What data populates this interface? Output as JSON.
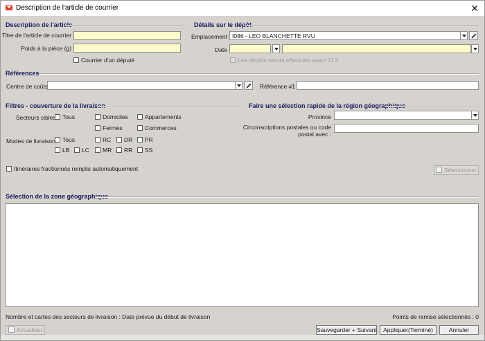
{
  "window": {
    "title": "Description de l'article de courrier",
    "close_glyph": "✕"
  },
  "article": {
    "section": "Description de l'article",
    "title_label": "Titre de l'article de courrier",
    "title_value": "",
    "weight_label": "Poids à la pièce (g)",
    "weight_value": "",
    "mp_label": "Courrier d'un député"
  },
  "deposit": {
    "section": "Détails sur le dépôt",
    "location_label": "Emplacement",
    "location_value": "I086 - LEO BLANCHETTE RVU",
    "date_label": "Date",
    "date_value": "",
    "time_value": "",
    "note": "Les dépôts seront effectués avant 11 h"
  },
  "references": {
    "section": "Références",
    "cost_center_label": "Centre de coûts",
    "cost_center_value": "",
    "ref1_label": "Référence #1",
    "ref1_value": ""
  },
  "filters": {
    "section": "Filtres - couverture de la livraison",
    "target_label": "Secteurs cibles",
    "target": [
      "Tous",
      "Domiciles",
      "Appartements",
      "Fermes",
      "Commerces"
    ],
    "modes_label": "Modes de livraison",
    "modes": [
      "Tous",
      "RC",
      "DR",
      "PR",
      "LB",
      "LC",
      "MR",
      "RR",
      "SS"
    ],
    "split_label": "Itinéraires fractionnés remplis automatiquement"
  },
  "quick": {
    "section": "Faire une sélection rapide de la région géographique",
    "province_label": "Province",
    "province_value": "",
    "postal_label_1": "Circonscriptions postales ou code",
    "postal_label_2": "postal avec :",
    "postal_value": "",
    "select_button": "Sélectionner"
  },
  "geo": {
    "section": "Sélection de la zone géographique"
  },
  "status": {
    "left": "Nombre et cartes des secteurs de livraison : Date prévue du début de livraison",
    "right": "Points de remise sélectionnés : 0"
  },
  "buttons": {
    "refresh": "Actualiser",
    "save_next": "Sauvegarder + Suivant",
    "apply": "Appliquer(Terminé)",
    "cancel": "Annuler"
  }
}
